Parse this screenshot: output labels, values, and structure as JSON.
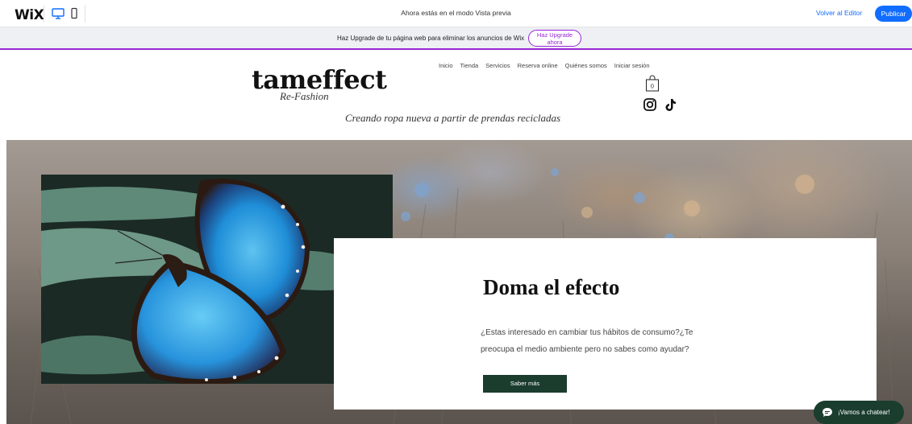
{
  "topbar": {
    "logo": "WiX",
    "preview_message": "Ahora estás en el modo Vista previa",
    "back_to_editor": "Volver al Editor",
    "publish": "Publicar",
    "desktop_icon": "desktop-icon",
    "mobile_icon": "mobile-icon",
    "accent_color": "#116dff"
  },
  "upgrade_banner": {
    "message": "Haz Upgrade de tu página web para eliminar los anuncios de Wix",
    "button_line1": "Haz Upgrade",
    "button_line2": "ahora",
    "accent_color": "#9a27d5"
  },
  "site": {
    "logo": "tameffect",
    "logo_sub": "Re-Fashion",
    "tagline": "Creando ropa nueva a partir de prendas recicladas",
    "nav": [
      "Inicio",
      "Tienda",
      "Servicios",
      "Reserva online",
      "Quiénes somos",
      "Iniciar sesión"
    ],
    "cart_count": "0",
    "social_icons": [
      "instagram-icon",
      "tiktok-icon"
    ]
  },
  "hero": {
    "title": "Doma el efecto",
    "text": "¿Estas interesado en cambiar tus hábitos de consumo?¿Te preocupa el medio ambiente pero no sabes como ayudar?",
    "button": "Saber más",
    "button_color": "#1a3d2e"
  },
  "chat": {
    "label": "¡Vamos a chatear!",
    "icon": "chat-bubble-icon"
  }
}
